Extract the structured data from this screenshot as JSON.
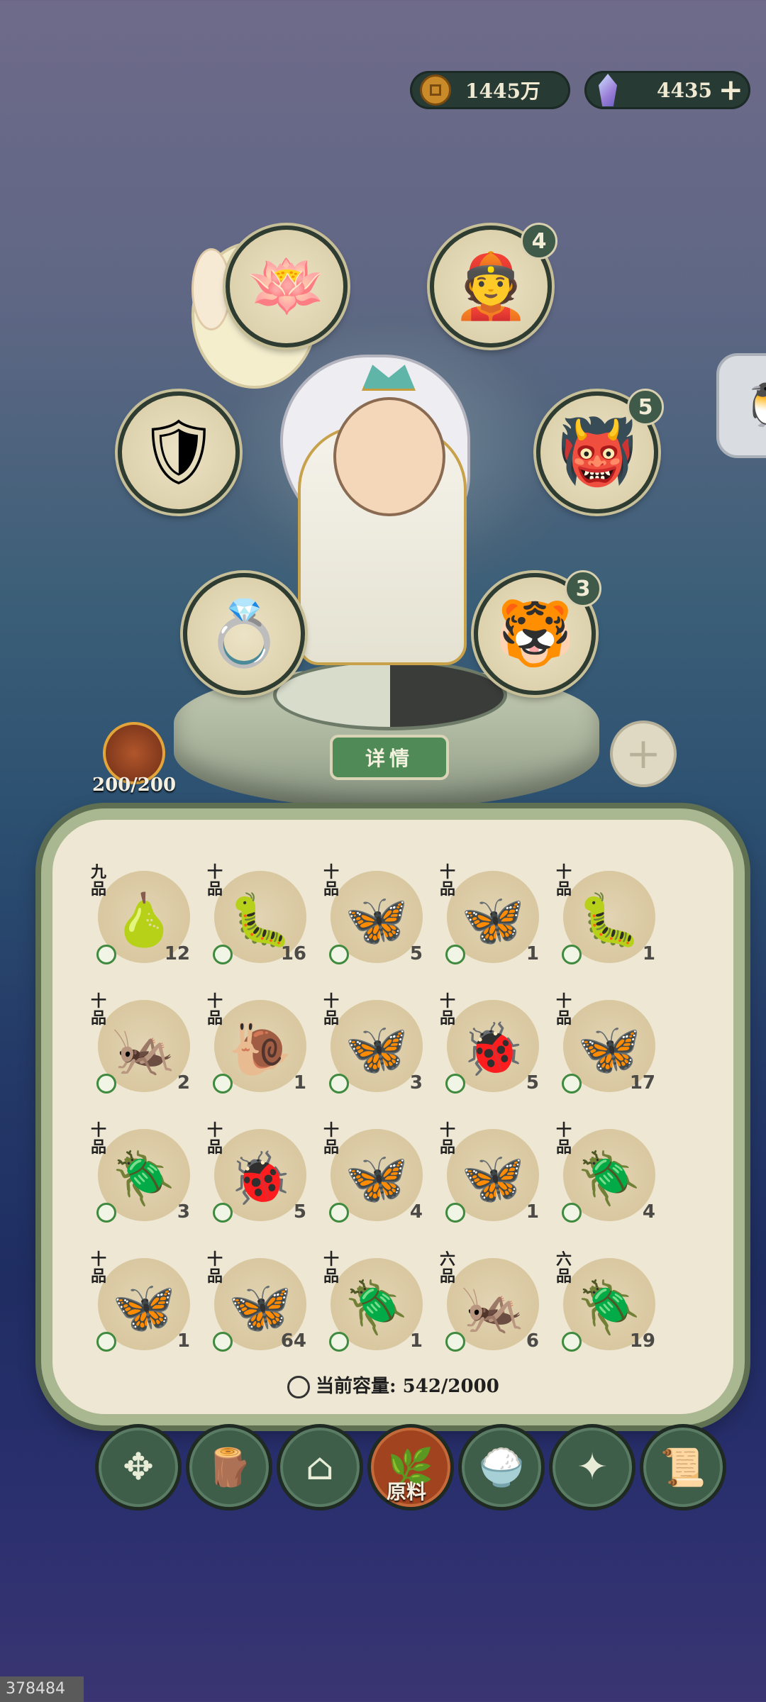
{
  "currency": {
    "coins": "1445万",
    "gems": "4435",
    "add_label": "+"
  },
  "equipment": [
    {
      "name": "lotus-lamp",
      "emblem": "🪷",
      "badge": ""
    },
    {
      "name": "official-spirit",
      "emblem": "👲",
      "badge": "4"
    },
    {
      "name": "golden-armor",
      "emblem": "🛡",
      "badge": ""
    },
    {
      "name": "fire-ghost",
      "emblem": "👹",
      "badge": "5"
    },
    {
      "name": "jade-ring",
      "emblem": "💍",
      "badge": ""
    },
    {
      "name": "tiger-spirit",
      "emblem": "🐯",
      "badge": "3"
    }
  ],
  "hero": {
    "detail_label": "详情",
    "add_label": "+",
    "stamina": "200/200"
  },
  "inventory": {
    "items": [
      {
        "grade": "九品",
        "icon": "🍐",
        "count": "12"
      },
      {
        "grade": "十品",
        "icon": "🐛",
        "count": "16"
      },
      {
        "grade": "十品",
        "icon": "🦋",
        "count": "5"
      },
      {
        "grade": "十品",
        "icon": "🦋",
        "count": "1"
      },
      {
        "grade": "十品",
        "icon": "🐛",
        "count": "1"
      },
      {
        "grade": "十品",
        "icon": "🦗",
        "count": "2"
      },
      {
        "grade": "十品",
        "icon": "🐌",
        "count": "1"
      },
      {
        "grade": "十品",
        "icon": "🦋",
        "count": "3"
      },
      {
        "grade": "十品",
        "icon": "🐞",
        "count": "5"
      },
      {
        "grade": "十品",
        "icon": "🦋",
        "count": "17"
      },
      {
        "grade": "十品",
        "icon": "🪲",
        "count": "3"
      },
      {
        "grade": "十品",
        "icon": "🐞",
        "count": "5"
      },
      {
        "grade": "十品",
        "icon": "🦋",
        "count": "4"
      },
      {
        "grade": "十品",
        "icon": "🦋",
        "count": "1"
      },
      {
        "grade": "十品",
        "icon": "🪲",
        "count": "4"
      },
      {
        "grade": "十品",
        "icon": "🦋",
        "count": "1"
      },
      {
        "grade": "十品",
        "icon": "🦋",
        "count": "64"
      },
      {
        "grade": "十品",
        "icon": "🪲",
        "count": "1"
      },
      {
        "grade": "六品",
        "icon": "🦗",
        "count": "6"
      },
      {
        "grade": "六品",
        "icon": "🪲",
        "count": "19"
      }
    ],
    "capacity_label": "当前容量: 542/2000"
  },
  "nav": [
    {
      "name": "nav-all",
      "icon": "✥",
      "label": ""
    },
    {
      "name": "nav-wood",
      "icon": "🪵",
      "label": ""
    },
    {
      "name": "nav-house",
      "icon": "⌂",
      "label": ""
    },
    {
      "name": "nav-materials",
      "icon": "🌿",
      "label": "原料"
    },
    {
      "name": "nav-food",
      "icon": "🍚",
      "label": ""
    },
    {
      "name": "nav-shard",
      "icon": "✦",
      "label": ""
    },
    {
      "name": "nav-scroll",
      "icon": "📜",
      "label": ""
    }
  ],
  "watermark": "378484",
  "side_tab": {
    "icon": "🐧"
  }
}
